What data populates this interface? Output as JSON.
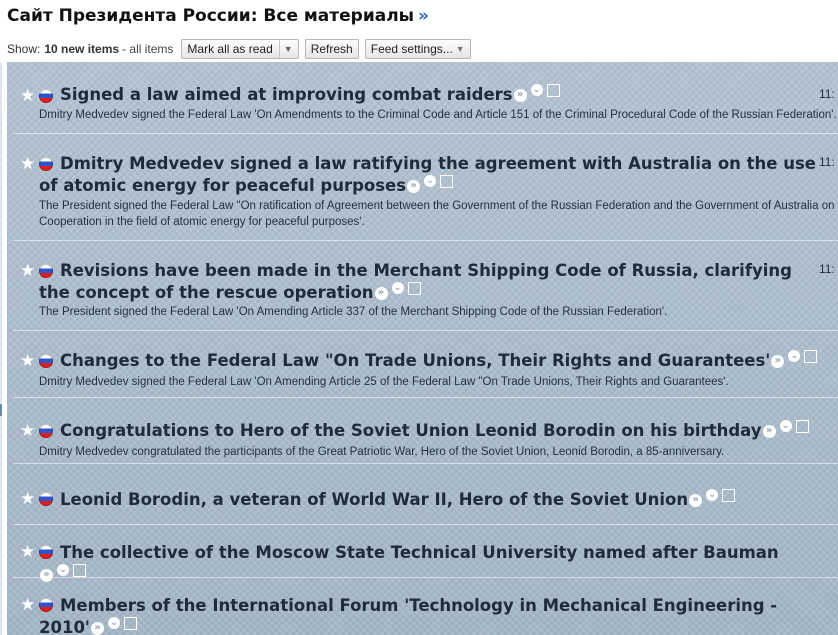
{
  "header": {
    "title": "Сайт Президента России: Все материалы",
    "more_link": "»"
  },
  "toolbar": {
    "show_label": "Show:",
    "count_label": "10 new items",
    "all_label": "- all items",
    "mark_all_read": "Mark all as read",
    "refresh": "Refresh",
    "feed_settings": "Feed settings..."
  },
  "items": [
    {
      "title": "Signed a law aimed at improving combat raiders",
      "snippet": "Dmitry Medvedev signed the Federal Law 'On Amendments to the Criminal Code and Article 151 of the Criminal Procedural Code of the Russian Federation'.",
      "time": "11:"
    },
    {
      "title": "Dmitry Medvedev signed a law ratifying the agreement with Australia on the use of atomic energy for peaceful purposes",
      "snippet": "The President signed the Federal Law \"On ratification of Agreement between the Government of the Russian Federation and the Government of Australia on Cooperation in the field of atomic energy for peaceful purposes'.",
      "time": "11:"
    },
    {
      "title": "Revisions have been made in the Merchant Shipping Code of Russia, clarifying the concept of the rescue operation",
      "snippet": "The President signed the Federal Law 'On Amending Article 337 of the Merchant Shipping Code of the Russian Federation'.",
      "time": "11:"
    },
    {
      "title": "Changes to the Federal Law \"On Trade Unions, Their Rights and Guarantees'",
      "snippet": "Dmitry Medvedev signed the Federal Law 'On Amending Article 25 of the Federal Law \"On Trade Unions, Their Rights and Guarantees'.",
      "time": ""
    },
    {
      "title": "Congratulations to Hero of the Soviet Union Leonid Borodin on his birthday",
      "snippet": "Dmitry Medvedev congratulated the participants of the Great Patriotic War, Hero of the Soviet Union, Leonid Borodin, a 85-anniversary.",
      "time": ""
    },
    {
      "title": "Leonid Borodin, a veteran of World War II, Hero of the Soviet Union",
      "snippet": "",
      "time": ""
    },
    {
      "title": "The collective of the Moscow State Technical University named after Bauman",
      "snippet": "",
      "time": ""
    },
    {
      "title": "Members of the International Forum 'Technology in Mechanical Engineering - 2010'",
      "snippet": "",
      "time": ""
    }
  ],
  "glyphs": {
    "star": "★",
    "more": "»",
    "chevron": "⌄"
  },
  "colors": {
    "feed_background": "#a8b9c8",
    "link_blue": "#3366cc",
    "title_text": "#1d2b3a"
  }
}
